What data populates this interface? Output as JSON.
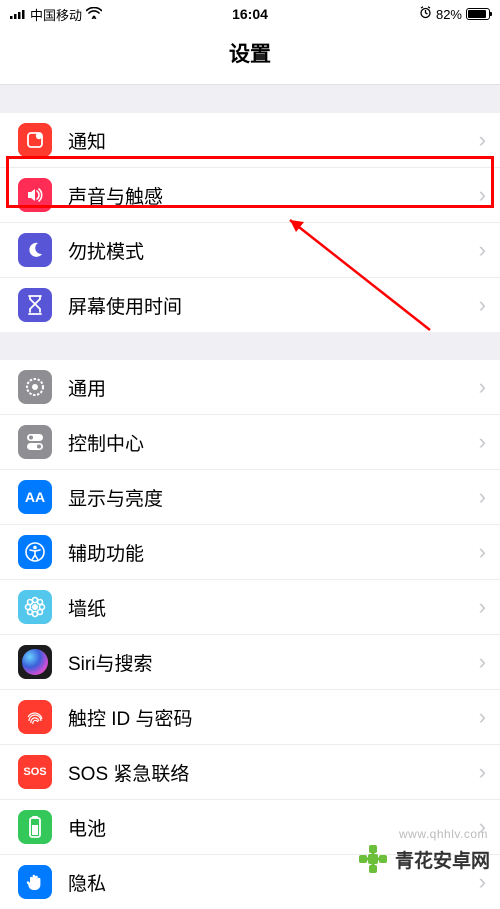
{
  "status": {
    "carrier": "中国移动",
    "time": "16:04",
    "battery_pct": "82%"
  },
  "header": {
    "title": "设置"
  },
  "groups": [
    {
      "rows": [
        {
          "id": "notifications",
          "label": "通知",
          "icon_bg": "#ff3b30",
          "icon_name": "notification-icon"
        },
        {
          "id": "sounds",
          "label": "声音与触感",
          "icon_bg": "#ff2d55",
          "icon_name": "speaker-icon",
          "highlighted": true
        },
        {
          "id": "dnd",
          "label": "勿扰模式",
          "icon_bg": "#5856d6",
          "icon_name": "moon-icon"
        },
        {
          "id": "screentime",
          "label": "屏幕使用时间",
          "icon_bg": "#5856d6",
          "icon_name": "hourglass-icon"
        }
      ]
    },
    {
      "rows": [
        {
          "id": "general",
          "label": "通用",
          "icon_bg": "#8e8e93",
          "icon_name": "gear-icon"
        },
        {
          "id": "controlcenter",
          "label": "控制中心",
          "icon_bg": "#8e8e93",
          "icon_name": "toggles-icon"
        },
        {
          "id": "display",
          "label": "显示与亮度",
          "icon_bg": "#007aff",
          "icon_name": "aa-icon"
        },
        {
          "id": "accessibility",
          "label": "辅助功能",
          "icon_bg": "#007aff",
          "icon_name": "person-icon"
        },
        {
          "id": "wallpaper",
          "label": "墙纸",
          "icon_bg": "#54c7ec",
          "icon_name": "flower-icon"
        },
        {
          "id": "siri",
          "label": "Siri与搜索",
          "icon_bg": "#1c1c1e",
          "icon_name": "siri-icon"
        },
        {
          "id": "touchid",
          "label": "触控 ID 与密码",
          "icon_bg": "#ff3b30",
          "icon_name": "fingerprint-icon"
        },
        {
          "id": "sos",
          "label": "SOS 紧急联络",
          "icon_bg": "#ff3b30",
          "icon_name": "sos-icon",
          "icon_text": "SOS"
        },
        {
          "id": "battery",
          "label": "电池",
          "icon_bg": "#34c759",
          "icon_name": "battery-icon"
        },
        {
          "id": "privacy",
          "label": "隐私",
          "icon_bg": "#007aff",
          "icon_name": "hand-icon"
        }
      ]
    }
  ],
  "watermark": {
    "brand": "青花安卓网",
    "url": "www.qhhlv.com"
  }
}
